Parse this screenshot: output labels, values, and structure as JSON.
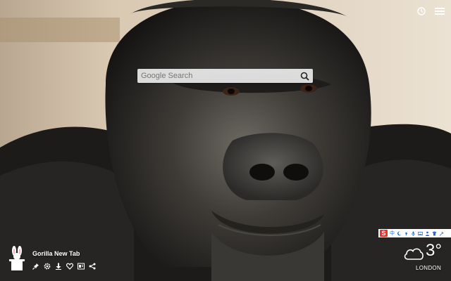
{
  "background": {
    "subject": "gorilla-face-photo"
  },
  "header": {
    "history_icon": "history-icon",
    "menu_icon": "menu-icon"
  },
  "search": {
    "placeholder": "Google Search",
    "icon": "search-icon"
  },
  "brand": {
    "title": "Gorilla New Tab",
    "logo": "bunny-hat-logo"
  },
  "tools": [
    "pin-icon",
    "settings-icon",
    "download-icon",
    "heart-icon",
    "layout-icon",
    "share-icon"
  ],
  "extension_bar": {
    "badge": "S",
    "items": [
      "中",
      "moon",
      "comma",
      "mic",
      "keyboard",
      "person",
      "shirt",
      "wrench"
    ]
  },
  "weather": {
    "temperature": "3°",
    "city": "LONDON",
    "icon": "cloud-icon"
  },
  "colors": {
    "ext_red": "#e8332a",
    "ext_blue": "#2a6bd1"
  }
}
